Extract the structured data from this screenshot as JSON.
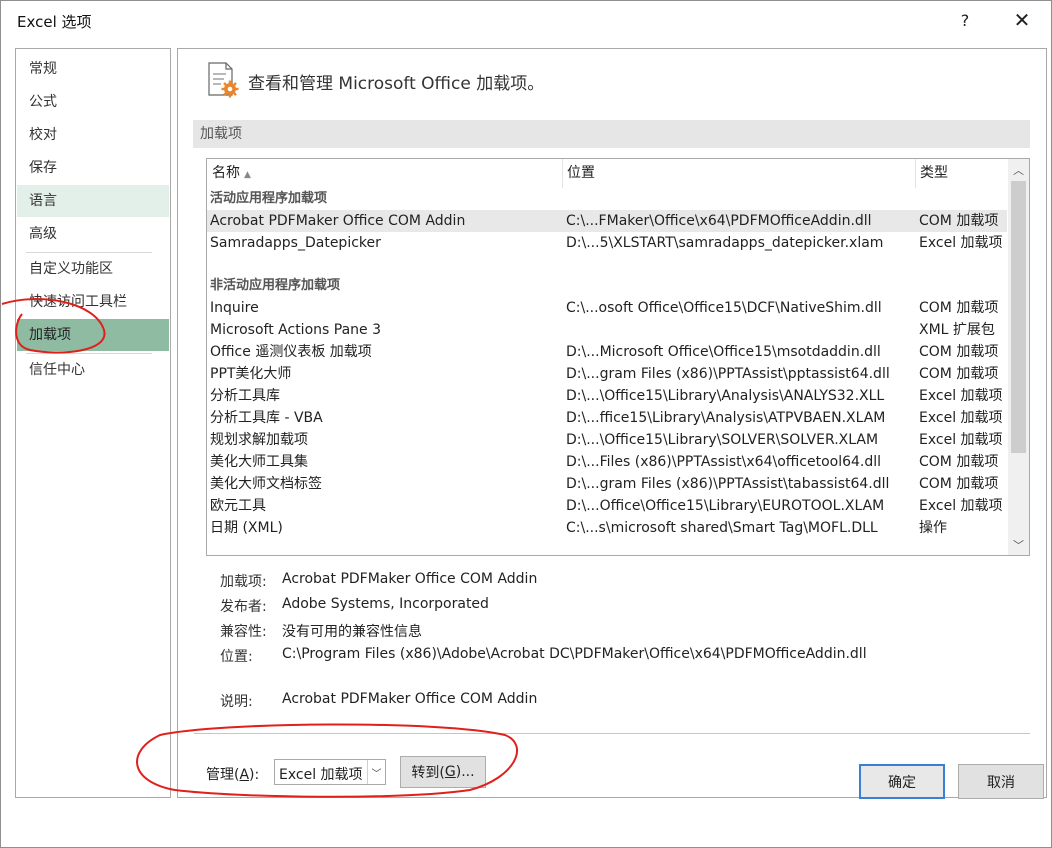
{
  "window": {
    "title": "Excel 选项",
    "help": "?",
    "close": "✕"
  },
  "sidebar": {
    "items": [
      {
        "label": "常规"
      },
      {
        "label": "公式"
      },
      {
        "label": "校对"
      },
      {
        "label": "保存"
      },
      {
        "label": "语言"
      },
      {
        "label": "高级"
      },
      {
        "label": "自定义功能区"
      },
      {
        "label": "快速访问工具栏"
      },
      {
        "label": "加载项"
      },
      {
        "label": "信任中心"
      }
    ],
    "active": "加载项"
  },
  "header": {
    "icon": "addins-gear-icon",
    "text": "查看和管理 Microsoft Office 加载项。"
  },
  "section": {
    "title": "加载项"
  },
  "grid": {
    "columns": [
      "名称",
      "位置",
      "类型"
    ],
    "sort_column": "名称",
    "sort_direction": "ascending",
    "groups": [
      {
        "label": "活动应用程序加载项",
        "rows": [
          {
            "name": "Acrobat PDFMaker Office COM Addin",
            "location": "C:\\...FMaker\\Office\\x64\\PDFMOfficeAddin.dll",
            "type": "COM 加载项",
            "selected": true
          },
          {
            "name": "Samradapps_Datepicker",
            "location": "D:\\...5\\XLSTART\\samradapps_datepicker.xlam",
            "type": "Excel 加载项"
          }
        ]
      },
      {
        "label": "非活动应用程序加载项",
        "rows": [
          {
            "name": "Inquire",
            "location": "C:\\...osoft Office\\Office15\\DCF\\NativeShim.dll",
            "type": "COM 加载项"
          },
          {
            "name": "Microsoft Actions Pane 3",
            "location": "",
            "type": "XML 扩展包"
          },
          {
            "name": "Office 遥测仪表板 加载项",
            "location": "D:\\...Microsoft Office\\Office15\\msotdaddin.dll",
            "type": "COM 加载项"
          },
          {
            "name": "PPT美化大师",
            "location": "D:\\...gram Files (x86)\\PPTAssist\\pptassist64.dll",
            "type": "COM 加载项"
          },
          {
            "name": "分析工具库",
            "location": "D:\\...\\Office15\\Library\\Analysis\\ANALYS32.XLL",
            "type": "Excel 加载项"
          },
          {
            "name": "分析工具库 - VBA",
            "location": "D:\\...ffice15\\Library\\Analysis\\ATPVBAEN.XLAM",
            "type": "Excel 加载项"
          },
          {
            "name": "规划求解加载项",
            "location": "D:\\...\\Office15\\Library\\SOLVER\\SOLVER.XLAM",
            "type": "Excel 加载项"
          },
          {
            "name": "美化大师工具集",
            "location": "D:\\...Files (x86)\\PPTAssist\\x64\\officetool64.dll",
            "type": "COM 加载项"
          },
          {
            "name": "美化大师文档标签",
            "location": "D:\\...gram Files (x86)\\PPTAssist\\tabassist64.dll",
            "type": "COM 加载项"
          },
          {
            "name": "欧元工具",
            "location": "D:\\...Office\\Office15\\Library\\EUROTOOL.XLAM",
            "type": "Excel 加载项"
          },
          {
            "name": "日期 (XML)",
            "location": "C:\\...s\\microsoft shared\\Smart Tag\\MOFL.DLL",
            "type": "操作"
          }
        ]
      }
    ]
  },
  "details": {
    "addin_label": "加载项:",
    "addin_value": "Acrobat PDFMaker Office COM Addin",
    "publisher_label": "发布者:",
    "publisher_value": "Adobe Systems, Incorporated",
    "compat_label": "兼容性:",
    "compat_value": "没有可用的兼容性信息",
    "location_label": "位置:",
    "location_value": "C:\\Program Files (x86)\\Adobe\\Acrobat DC\\PDFMaker\\Office\\x64\\PDFMOfficeAddin.dll",
    "desc_label": "说明:",
    "desc_value": "Acrobat PDFMaker Office COM Addin"
  },
  "manage": {
    "label_prefix": "管理(",
    "label_key": "A",
    "label_suffix": "):",
    "selected": "Excel 加载项",
    "goto_prefix": "转到(",
    "goto_key": "G",
    "goto_suffix": ")..."
  },
  "footer": {
    "ok": "确定",
    "cancel": "取消"
  },
  "colors": {
    "active_sidebar": "#8ebba1",
    "hover_sidebar": "#e3efe9",
    "annotation": "#e0201a",
    "ok_border": "#3b7fd4"
  }
}
